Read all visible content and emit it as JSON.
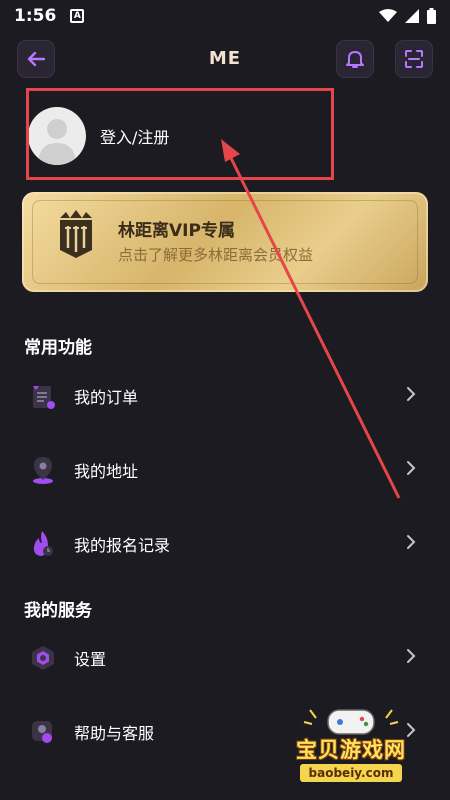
{
  "status_bar": {
    "time": "1:56",
    "badge": "A"
  },
  "header": {
    "title": "ME",
    "back_icon": "arrow-left-icon",
    "bell_icon": "bell-icon",
    "scan_icon": "scan-icon"
  },
  "login": {
    "label": "登入/注册"
  },
  "vip": {
    "title": "林距离VIP专属",
    "subtitle": "点击了解更多林距离会员权益"
  },
  "sections": {
    "common": {
      "title": "常用功能",
      "items": [
        {
          "label": "我的订单",
          "icon": "order-list-icon"
        },
        {
          "label": "我的地址",
          "icon": "location-pin-icon"
        },
        {
          "label": "我的报名记录",
          "icon": "flame-record-icon"
        }
      ]
    },
    "services": {
      "title": "我的服务",
      "items": [
        {
          "label": "设置",
          "icon": "settings-hexagon-icon"
        },
        {
          "label": "帮助与客服",
          "icon": "customer-service-icon"
        }
      ]
    }
  },
  "watermark": {
    "title": "宝贝游戏网",
    "url": "baobeiy.com"
  },
  "colors": {
    "background": "#1d1b22",
    "accent_purple": "#a04cf0",
    "annotation_red": "#e4464a",
    "vip_gold": "#d7b56a"
  }
}
